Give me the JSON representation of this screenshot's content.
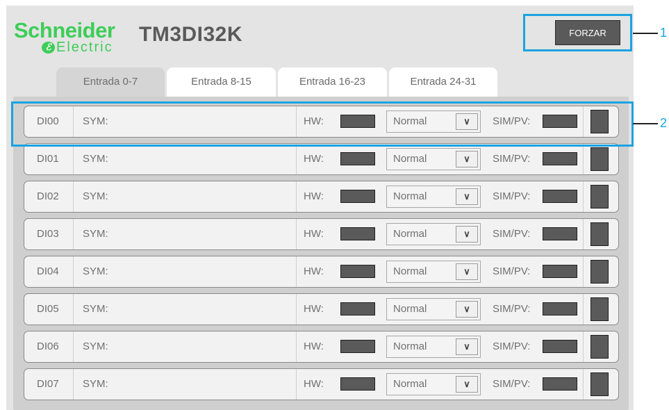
{
  "brand": {
    "name": "Schneider",
    "sub": "Electric",
    "mark": "ℰ"
  },
  "module": {
    "title": "TM3DI32K"
  },
  "toolbar": {
    "force_label": "FORZAR"
  },
  "callouts": {
    "one": "1",
    "two": "2"
  },
  "tabs": [
    {
      "label": "Entrada 0-7",
      "active": true
    },
    {
      "label": "Entrada 8-15",
      "active": false
    },
    {
      "label": "Entrada 16-23",
      "active": false
    },
    {
      "label": "Entrada 24-31",
      "active": false
    }
  ],
  "labels": {
    "sym": "SYM:",
    "hw": "HW:",
    "simpv": "SIM/PV:",
    "arrow": "∨"
  },
  "rows": [
    {
      "id": "DI00",
      "mode": "Normal"
    },
    {
      "id": "DI01",
      "mode": "Normal"
    },
    {
      "id": "DI02",
      "mode": "Normal"
    },
    {
      "id": "DI03",
      "mode": "Normal"
    },
    {
      "id": "DI04",
      "mode": "Normal"
    },
    {
      "id": "DI05",
      "mode": "Normal"
    },
    {
      "id": "DI06",
      "mode": "Normal"
    },
    {
      "id": "DI07",
      "mode": "Normal"
    }
  ],
  "colors": {
    "brand_green": "#3dcd58",
    "callout_blue": "#1ba3e0",
    "indicator": "#5a5a5a"
  }
}
